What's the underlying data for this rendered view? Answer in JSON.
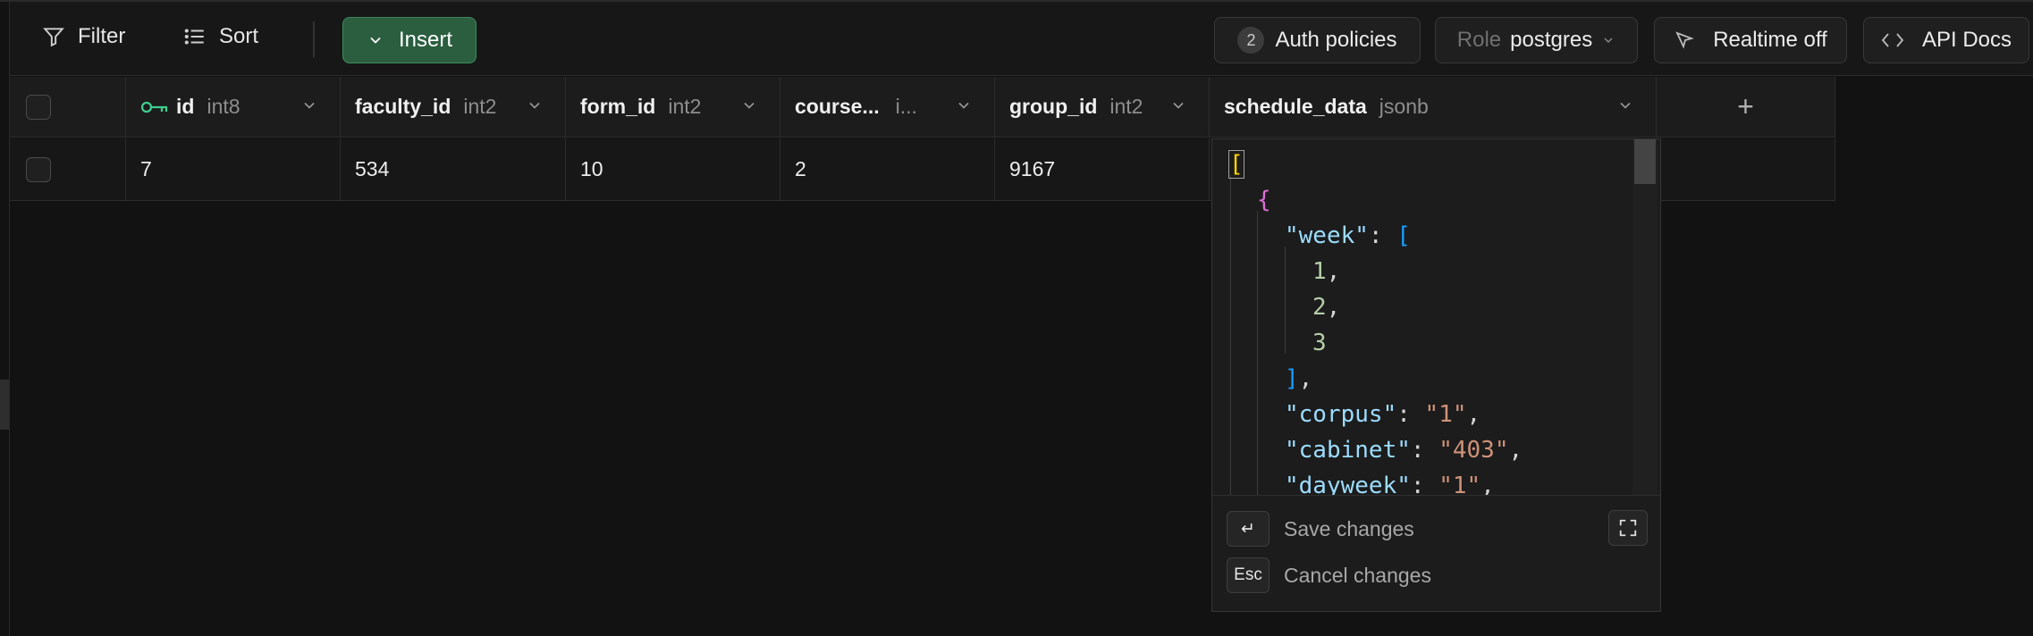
{
  "toolbar": {
    "filter_label": "Filter",
    "sort_label": "Sort",
    "insert_label": "Insert",
    "auth_count": "2",
    "auth_label": "Auth policies",
    "role_prefix": "Role",
    "role_value": "postgres",
    "realtime_label": "Realtime off",
    "api_docs_label": "API Docs"
  },
  "table": {
    "columns": [
      {
        "name": "id",
        "type": "int8"
      },
      {
        "name": "faculty_id",
        "type": "int2"
      },
      {
        "name": "form_id",
        "type": "int2"
      },
      {
        "name": "course...",
        "type": "i..."
      },
      {
        "name": "group_id",
        "type": "int2"
      },
      {
        "name": "schedule_data",
        "type": "jsonb"
      }
    ],
    "add_column_label": "+",
    "row": [
      "7",
      "534",
      "10",
      "2",
      "9167"
    ]
  },
  "editor": {
    "save_key": "↵",
    "save_label": "Save changes",
    "cancel_key": "Esc",
    "cancel_label": "Cancel changes",
    "tokens": {
      "open_bracket": "[",
      "open_brace": "{",
      "week_key": "\"week\"",
      "corpus_key": "\"corpus\"",
      "corpus_val": "\"1\"",
      "cabinet_key": "\"cabinet\"",
      "cabinet_val": "\"403\"",
      "dayweek_key": "\"dayweek\"",
      "dayweek_val": "\"1\"",
      "week_values": [
        "1",
        "2",
        "3"
      ]
    }
  }
}
